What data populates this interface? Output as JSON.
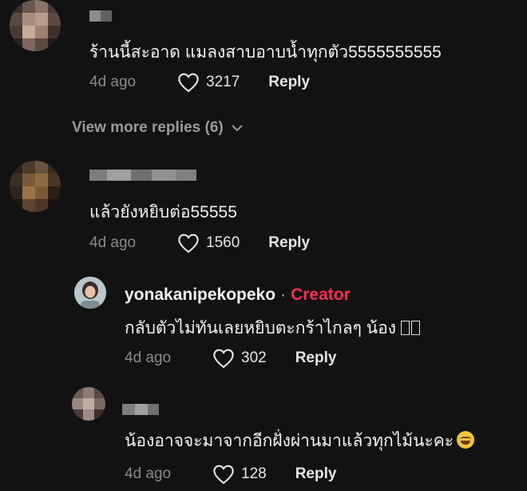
{
  "comments": [
    {
      "text": "ร้านนี้สะอาด แมลงสาบอาบน้ำทุกตัว5555555555",
      "time": "4d ago",
      "likes": "3217",
      "reply_label": "Reply"
    },
    {
      "view_more": "View more replies (6)",
      "text": "แล้วยังหยิบต่อ55555",
      "time": "4d ago",
      "likes": "1560",
      "reply_label": "Reply"
    }
  ],
  "replies": [
    {
      "username": "yonakanipekopeko",
      "separator": "·",
      "badge": "Creator",
      "text": "กลับตัวไม่ทันเลยหยิบตะกร้าไกลๆ น้อง",
      "time": "4d ago",
      "likes": "302",
      "reply_label": "Reply"
    },
    {
      "text": "น้องอาจจะมาจากอีกฝั่งผ่านมาแล้วทุกไม้นะคะ",
      "time": "4d ago",
      "likes": "128",
      "reply_label": "Reply"
    }
  ],
  "colors": {
    "background": "#121212",
    "creator_badge": "#fe2c55"
  },
  "icons": [
    "heart-icon",
    "chevron-down-icon",
    "laughing-emoji"
  ]
}
